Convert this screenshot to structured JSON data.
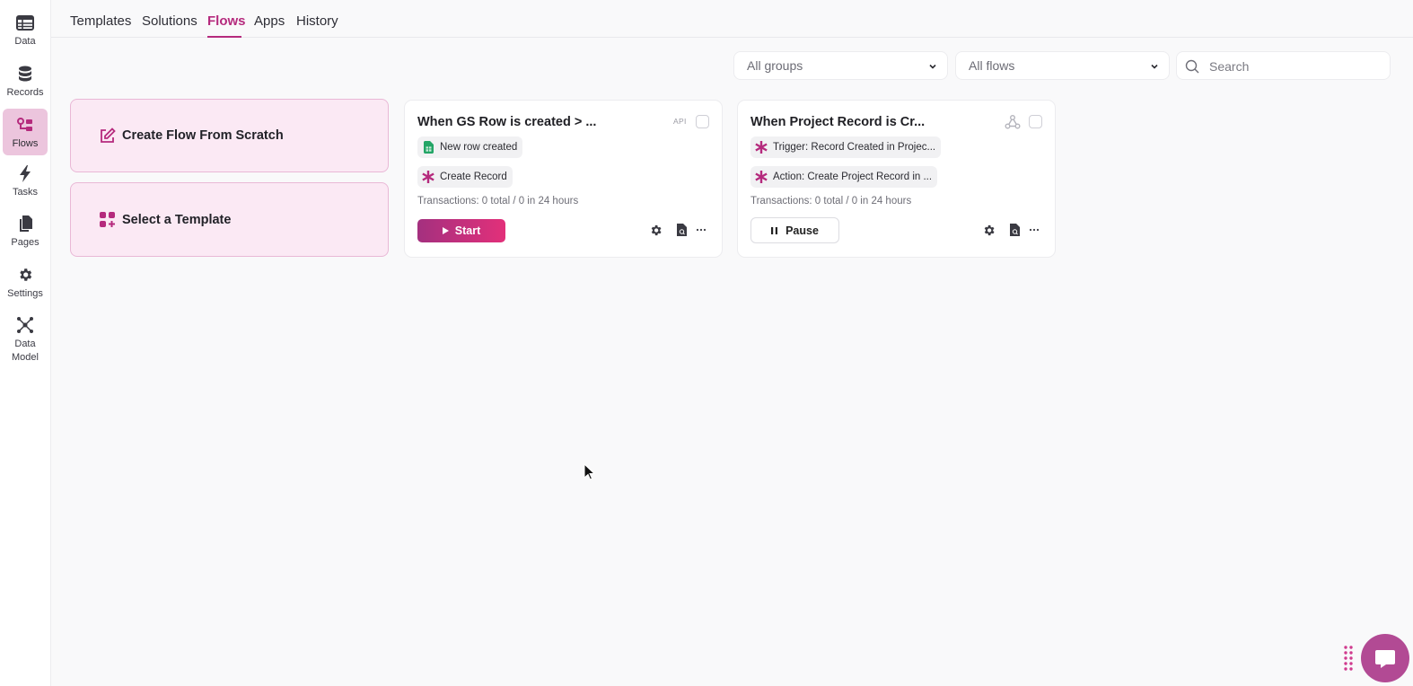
{
  "sidebar": {
    "items": [
      {
        "label": "Data",
        "icon": "table-icon"
      },
      {
        "label": "Records",
        "icon": "database-icon"
      },
      {
        "label": "Flows",
        "icon": "flows-icon",
        "active": true
      },
      {
        "label": "Tasks",
        "icon": "lightning-icon"
      },
      {
        "label": "Pages",
        "icon": "pages-icon"
      },
      {
        "label": "Settings",
        "icon": "gear-icon"
      },
      {
        "label": "Data\nModel",
        "label_line1": "Data",
        "label_line2": "Model",
        "icon": "network-icon"
      }
    ]
  },
  "tabs": [
    {
      "label": "Templates"
    },
    {
      "label": "Solutions"
    },
    {
      "label": "Flows",
      "active": true
    },
    {
      "label": "Apps"
    },
    {
      "label": "History"
    }
  ],
  "filters": {
    "groups": "All groups",
    "flows": "All flows",
    "search_placeholder": "Search"
  },
  "actions": {
    "create": "Create Flow From Scratch",
    "template": "Select a Template"
  },
  "flows": [
    {
      "title": "When GS Row is created > ...",
      "badge": "API",
      "trigger": {
        "label": "New row created",
        "icon": "google-sheets-icon"
      },
      "action": {
        "label": "Create Record",
        "icon": "asterisk-icon"
      },
      "transactions": "Transactions: 0 total / 0 in 24 hours",
      "button": "Start",
      "status": "stopped"
    },
    {
      "title": "When Project Record is Cr...",
      "badge_icon": "webhook-icon",
      "trigger": {
        "label": "Trigger: Record Created in Projec...",
        "icon": "asterisk-icon"
      },
      "action": {
        "label": "Action: Create Project Record in ...",
        "icon": "asterisk-icon"
      },
      "transactions": "Transactions: 0 total / 0 in 24 hours",
      "button": "Pause",
      "status": "running"
    }
  ],
  "colors": {
    "accent": "#b52a7d",
    "action_card_bg": "#fbe9f4",
    "sidebar_active": "#ecc5dd",
    "start_gradient_from": "#a4307f",
    "start_gradient_to": "#e2307a",
    "chat_button": "#b24a94"
  }
}
